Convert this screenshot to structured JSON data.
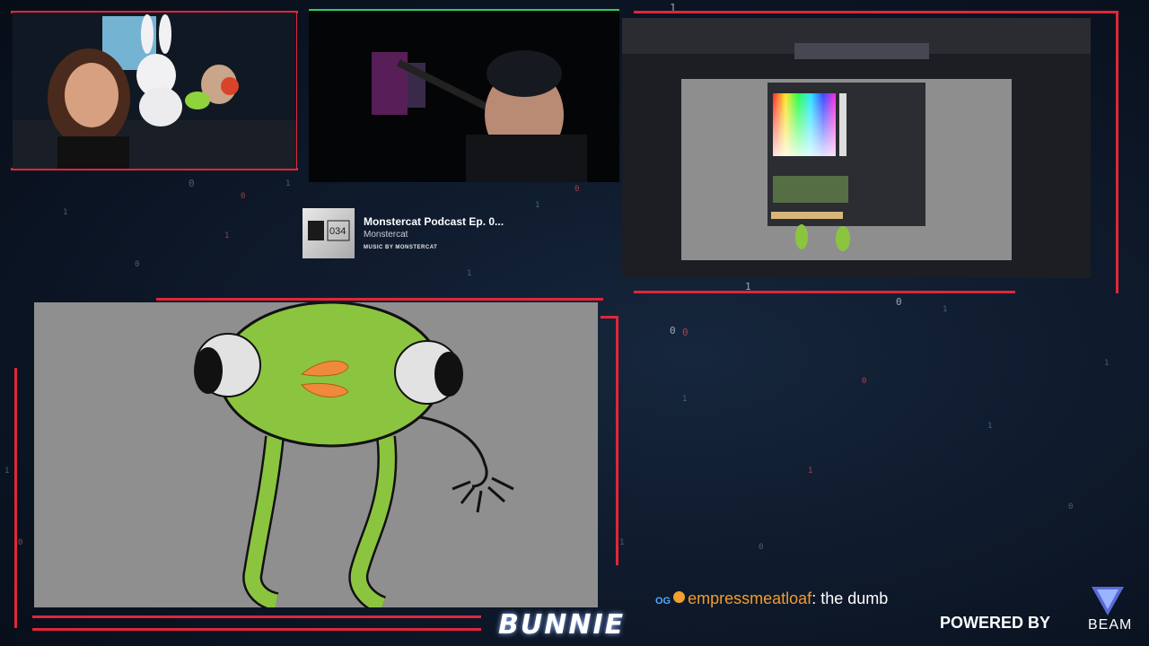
{
  "now_playing": {
    "title": "Monstercat Podcast Ep. 0...",
    "artist": "Monstercat",
    "subtitle": "MUSIC BY MONSTERCAT",
    "art_label": "034"
  },
  "chat": {
    "badge": "OG",
    "username": "empressmeatloaf",
    "separator": ":",
    "message": "the dumb"
  },
  "branding": {
    "streamer": "BUNNIE",
    "powered_by": "POWERED BY",
    "sponsor": "BEAM"
  },
  "colors": {
    "accent_red": "#e0263a",
    "username_orange": "#f39c2e",
    "frog_green": "#8bc540",
    "canvas_gray": "#8f8f8f"
  }
}
